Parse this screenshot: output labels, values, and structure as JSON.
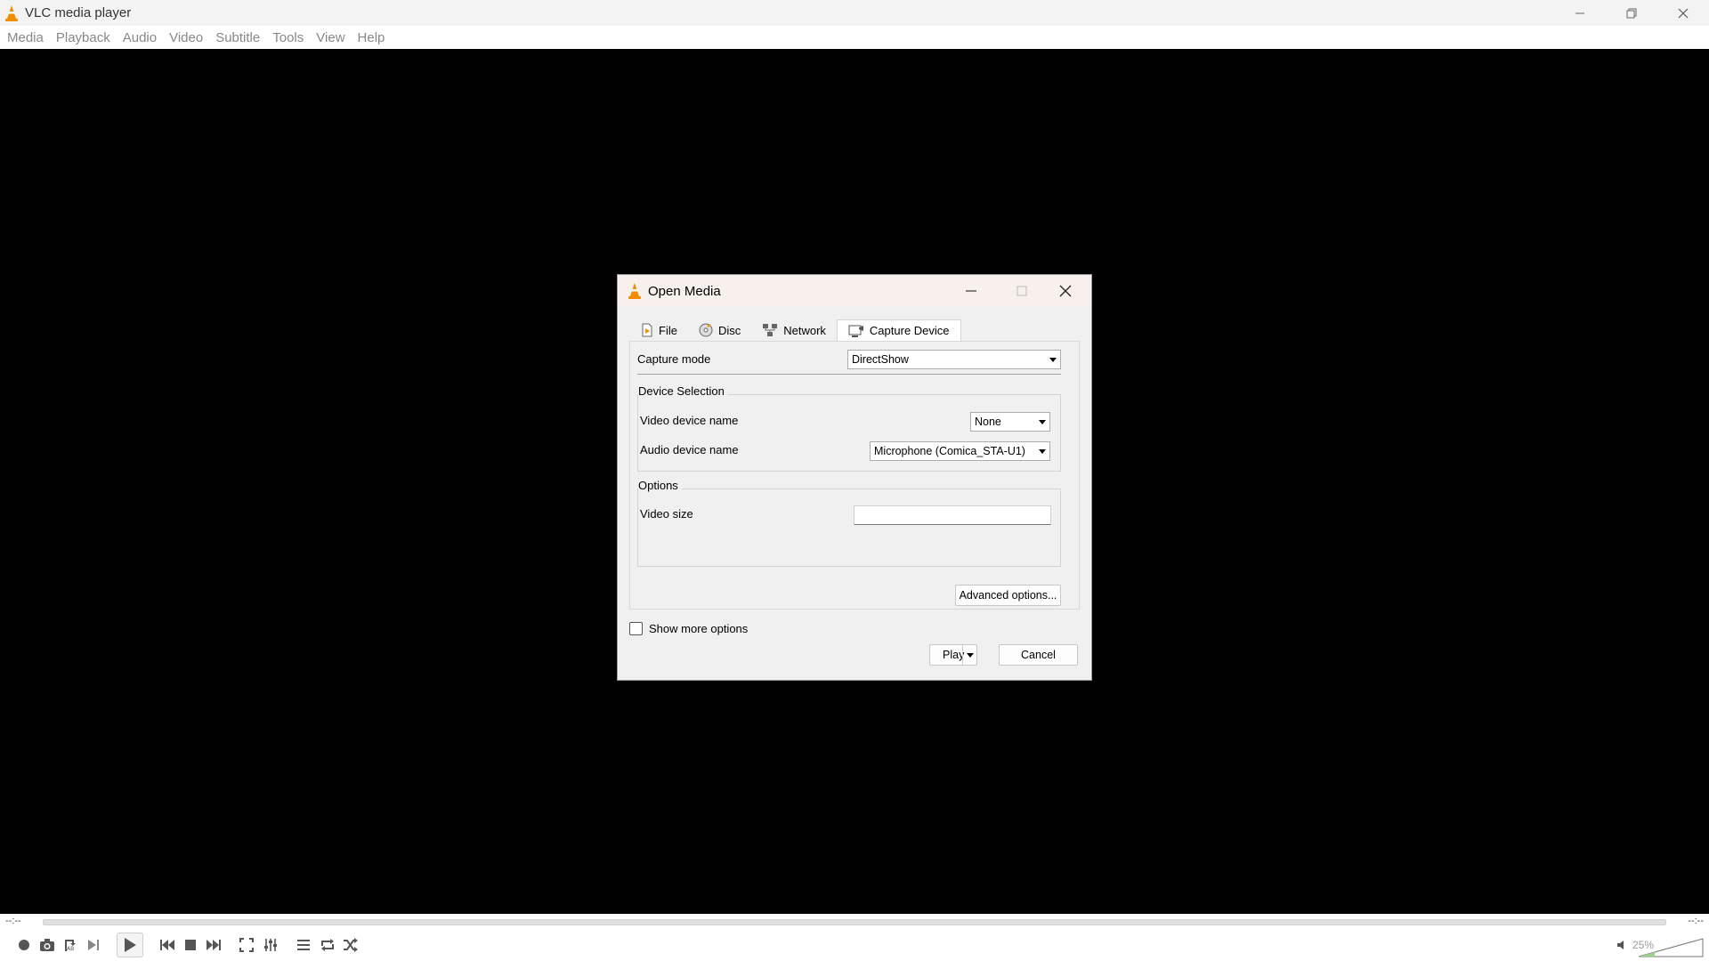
{
  "window": {
    "title": "VLC media player",
    "controls": {
      "minimize": "—",
      "restore": "❐",
      "close": "✕"
    }
  },
  "menu": [
    "Media",
    "Playback",
    "Audio",
    "Video",
    "Subtitle",
    "Tools",
    "View",
    "Help"
  ],
  "player": {
    "time_elapsed": "--:--",
    "time_total": "--:--",
    "volume": "25%",
    "volume_level": 0.25,
    "seek_progress": 0
  },
  "dialog": {
    "title": "Open Media",
    "tabs": [
      {
        "label": "File",
        "icon": "file-icon"
      },
      {
        "label": "Disc",
        "icon": "disc-icon"
      },
      {
        "label": "Network",
        "icon": "network-icon"
      },
      {
        "label": "Capture Device",
        "icon": "capture-device-icon",
        "active": true
      }
    ],
    "capture_mode_label": "Capture mode",
    "capture_mode_value": "DirectShow",
    "device_selection_title": "Device Selection",
    "video_device_label": "Video device name",
    "video_device_value": "None",
    "audio_device_label": "Audio device name",
    "audio_device_value": "Microphone (Comica_STA-U1)",
    "options_title": "Options",
    "video_size_label": "Video size",
    "video_size_value": "",
    "advanced_options_label": "Advanced options...",
    "show_more_options_label": "Show more options",
    "show_more_options_checked": false,
    "play_label": "Play",
    "cancel_label": "Cancel"
  },
  "colors": {
    "vlc_orange": "#f28c00",
    "title_bg": "#f3f3f3",
    "dialog_title_bg": "#f7f0ec",
    "video_bg": "#000000"
  }
}
